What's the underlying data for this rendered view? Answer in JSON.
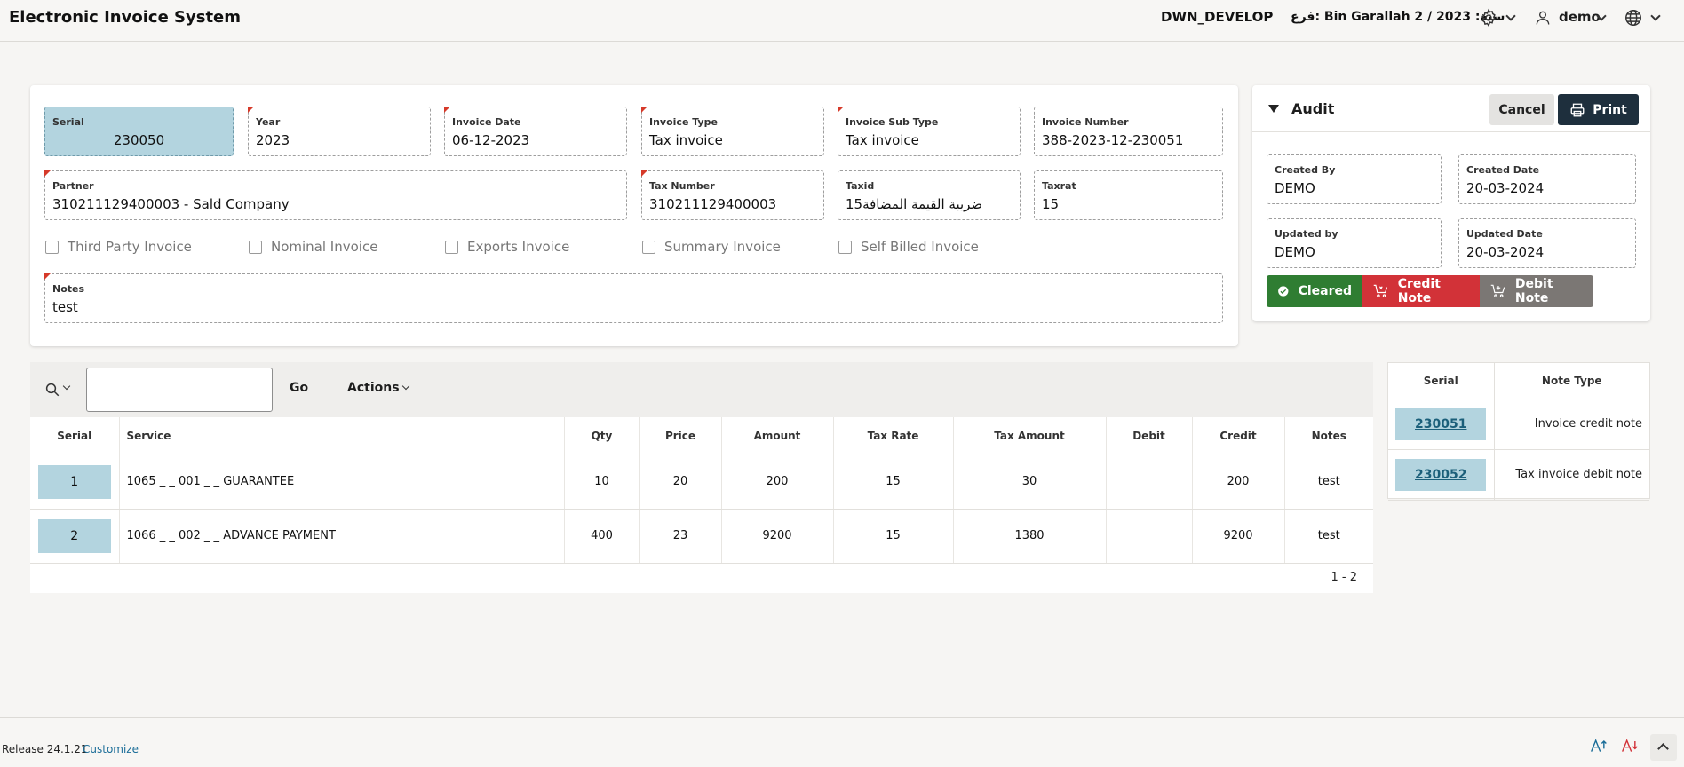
{
  "header": {
    "app_title": "Electronic Invoice System",
    "environment": "DWN_DEVELOP",
    "branch_info": "فرع: Bin Garallah 2 / 2023 :سنة",
    "user_name": "demo"
  },
  "form": {
    "serial": {
      "label": "Serial",
      "value": "230050"
    },
    "year": {
      "label": "Year",
      "value": "2023"
    },
    "invoice_date": {
      "label": "Invoice Date",
      "value": "06-12-2023"
    },
    "invoice_type": {
      "label": "Invoice Type",
      "value": "Tax invoice"
    },
    "invoice_sub_type": {
      "label": "Invoice Sub Type",
      "value": "Tax invoice"
    },
    "invoice_number": {
      "label": "Invoice Number",
      "value": "388-2023-12-230051"
    },
    "partner": {
      "label": "Partner",
      "value": "310211129400003 - Sald Company"
    },
    "tax_number": {
      "label": "Tax Number",
      "value": "310211129400003"
    },
    "taxid": {
      "label": "Taxid",
      "value": "ضريبة القيمة المضافة15"
    },
    "taxrat": {
      "label": "Taxrat",
      "value": "15"
    },
    "checkboxes": [
      "Third Party Invoice",
      "Nominal Invoice",
      "Exports Invoice",
      "Summary Invoice",
      "Self Billed Invoice"
    ],
    "notes": {
      "label": "Notes",
      "value": "test"
    }
  },
  "audit": {
    "title": "Audit",
    "cancel_label": "Cancel",
    "print_label": "Print",
    "created_by": {
      "label": "Created By",
      "value": "DEMO"
    },
    "created_date": {
      "label": "Created Date",
      "value": "20-03-2024"
    },
    "updated_by": {
      "label": "Updated by",
      "value": "DEMO"
    },
    "updated_date": {
      "label": "Updated Date",
      "value": "20-03-2024"
    },
    "status_cleared": "Cleared",
    "credit_note": "Credit Note",
    "debit_note": "Debit Note",
    "colors": {
      "cleared": "#2f7d32",
      "credit": "#d23238",
      "debit": "#7b7774"
    }
  },
  "lines": {
    "go_label": "Go",
    "actions_label": "Actions",
    "columns": [
      "Serial",
      "Service",
      "Qty",
      "Price",
      "Amount",
      "Tax Rate",
      "Tax Amount",
      "Debit",
      "Credit",
      "Notes"
    ],
    "rows": [
      {
        "serial": "1",
        "service": "1065 _ _ 001 _ _ GUARANTEE",
        "qty": "10",
        "price": "20",
        "amount": "200",
        "tax_rate": "15",
        "tax_amount": "30",
        "debit": "",
        "credit": "200",
        "notes": "test"
      },
      {
        "serial": "2",
        "service": "1066 _ _ 002 _ _ ADVANCE PAYMENT",
        "qty": "400",
        "price": "23",
        "amount": "9200",
        "tax_rate": "15",
        "tax_amount": "1380",
        "debit": "",
        "credit": "9200",
        "notes": "test"
      }
    ],
    "pagination": "1 - 2"
  },
  "related_notes": {
    "columns": [
      "Serial",
      "Note Type"
    ],
    "rows": [
      {
        "serial": "230051",
        "type": "Invoice credit note"
      },
      {
        "serial": "230052",
        "type": "Tax invoice debit note"
      }
    ]
  },
  "footer": {
    "release": "Release 24.1.21",
    "customize": "Customize"
  }
}
